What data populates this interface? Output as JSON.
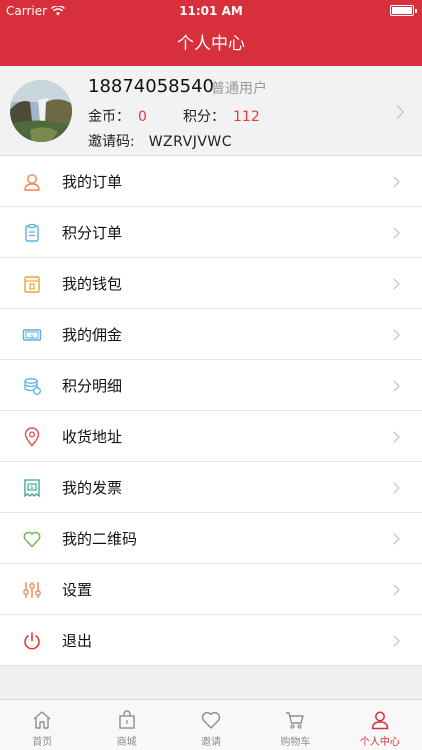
{
  "status_bar": {
    "carrier": "Carrier",
    "time": "11:01 AM"
  },
  "nav": {
    "title": "个人中心"
  },
  "profile": {
    "phone": "18874058540",
    "user_type": "普通用户",
    "coins_label": "金币：",
    "coins_value": "0",
    "points_label": "积分：",
    "points_value": "112",
    "invite_label": "邀请码:",
    "invite_code": "WZRVJVWC"
  },
  "menu": [
    {
      "label": "我的订单",
      "icon": "user-icon"
    },
    {
      "label": "积分订单",
      "icon": "clipboard-icon"
    },
    {
      "label": "我的钱包",
      "icon": "wallet-icon"
    },
    {
      "label": "我的佣金",
      "icon": "money-icon"
    },
    {
      "label": "积分明细",
      "icon": "coins-icon"
    },
    {
      "label": "收货地址",
      "icon": "location-pin-icon"
    },
    {
      "label": "我的发票",
      "icon": "invoice-icon"
    },
    {
      "label": "我的二维码",
      "icon": "heart-icon"
    },
    {
      "label": "设置",
      "icon": "sliders-icon"
    },
    {
      "label": "退出",
      "icon": "power-icon"
    }
  ],
  "tabs": [
    {
      "label": "首页",
      "icon": "home-icon"
    },
    {
      "label": "商城",
      "icon": "shopping-bag-icon"
    },
    {
      "label": "邀请",
      "icon": "heart-icon"
    },
    {
      "label": "购物车",
      "icon": "cart-icon"
    },
    {
      "label": "个人中心",
      "icon": "person-icon"
    }
  ],
  "colors": {
    "brand": "#d8303a",
    "accent_value": "#e03c3c",
    "tab_inactive": "#8e8e93"
  }
}
